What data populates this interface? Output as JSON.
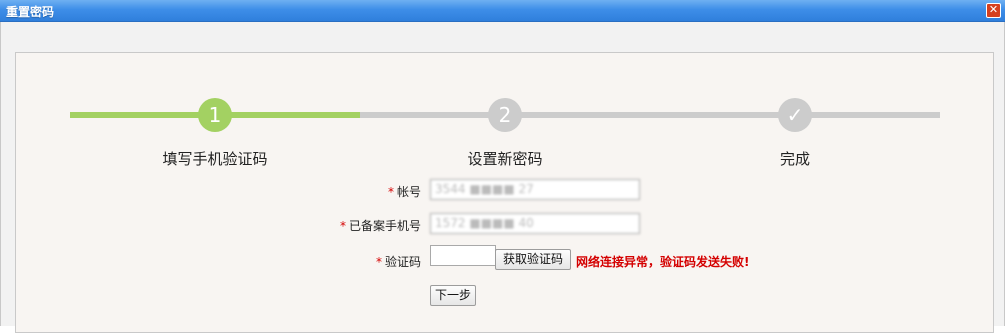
{
  "window": {
    "title": "重置密码",
    "close_label": "✕"
  },
  "steps": [
    {
      "number": "1",
      "label": "填写手机验证码",
      "state": "active"
    },
    {
      "number": "2",
      "label": "设置新密码",
      "state": "pending"
    },
    {
      "number": "✓",
      "label": "完成",
      "state": "pending"
    }
  ],
  "form": {
    "account": {
      "label": "帐号",
      "value": "3544 ■■■■ 27"
    },
    "phone": {
      "label": "已备案手机号",
      "value": "1572 ■■■■ 40"
    },
    "code": {
      "label": "验证码",
      "value": ""
    },
    "required_mark": "*",
    "get_code_button": "获取验证码",
    "error_message": "网络连接异常，验证码发送失败!",
    "next_button": "下一步"
  },
  "colors": {
    "active": "#a3d162",
    "pending": "#cccccc",
    "error": "#d40000",
    "titlebar": "#3e8ee8"
  }
}
